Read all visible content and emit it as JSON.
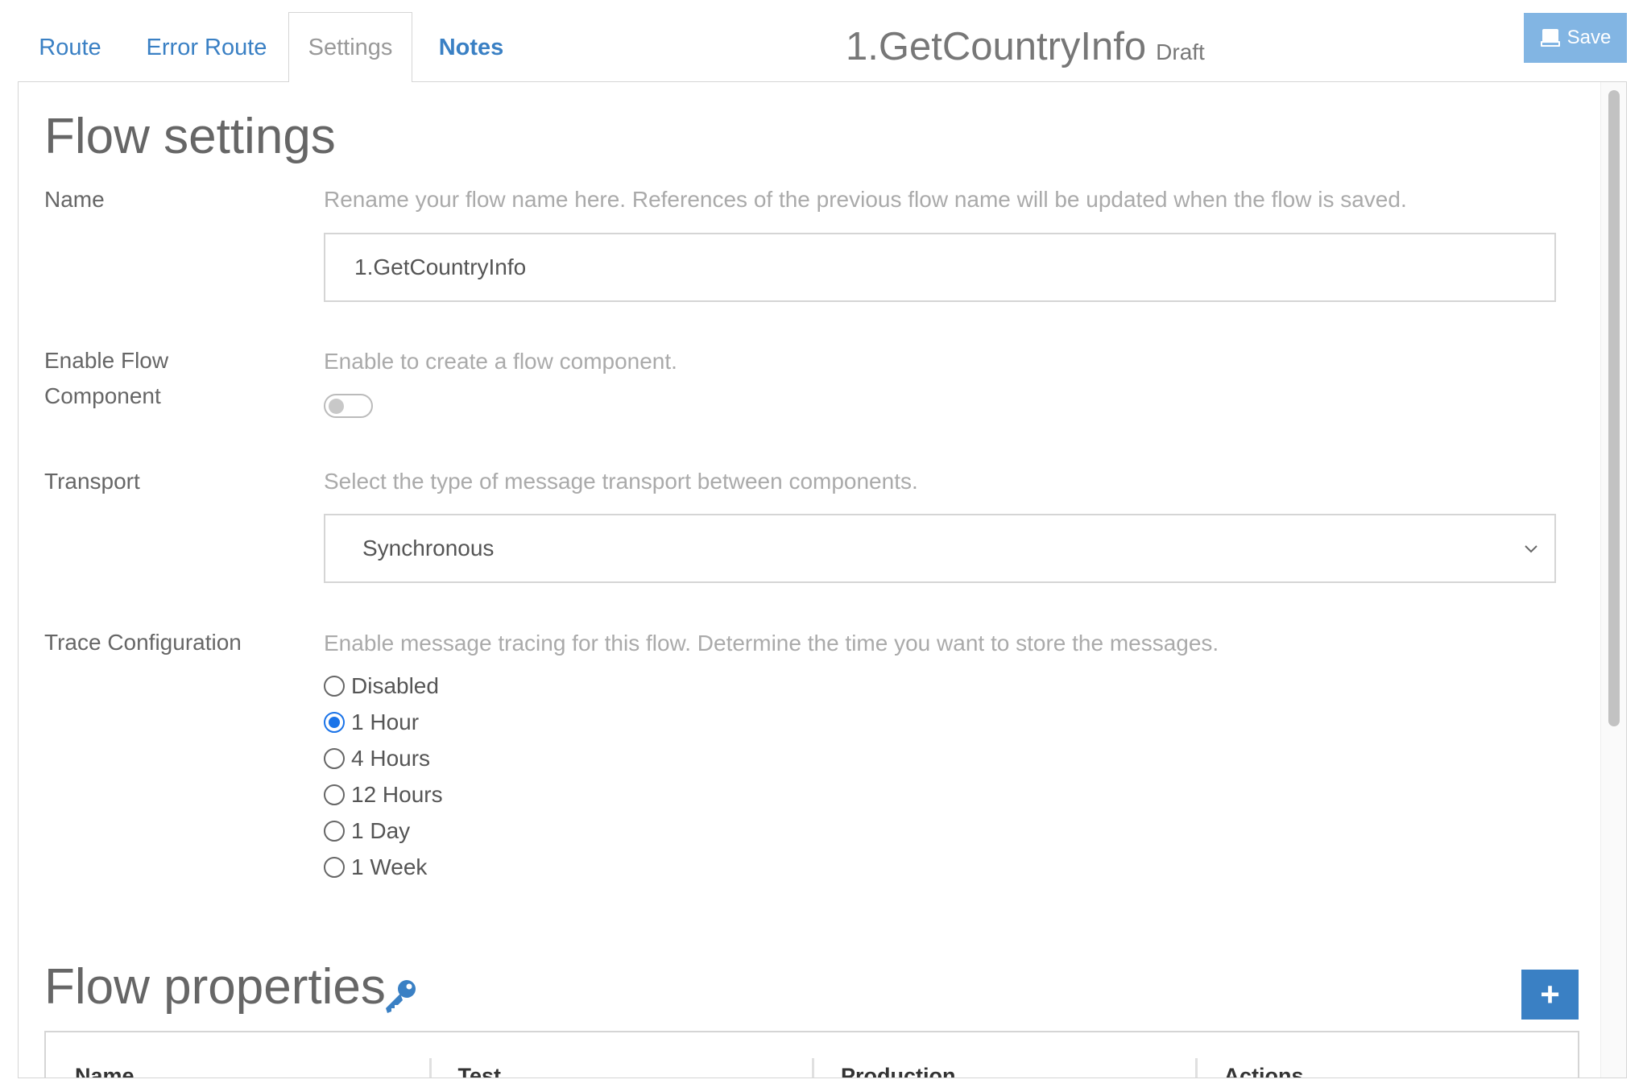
{
  "tabs": {
    "route": "Route",
    "error_route": "Error Route",
    "settings": "Settings",
    "notes": "Notes"
  },
  "header": {
    "flow_name": "1.GetCountryInfo",
    "status": "Draft",
    "save_label": "Save"
  },
  "flow_settings": {
    "heading": "Flow settings",
    "name": {
      "label": "Name",
      "help": "Rename your flow name here. References of the previous flow name will be updated when the flow is saved.",
      "value": "1.GetCountryInfo"
    },
    "enable_component": {
      "label": "Enable Flow Component",
      "help": "Enable to create a flow component.",
      "enabled": false
    },
    "transport": {
      "label": "Transport",
      "help": "Select the type of message transport between components.",
      "selected": "Synchronous"
    },
    "trace": {
      "label": "Trace Configuration",
      "help": "Enable message tracing for this flow. Determine the time you want to store the messages.",
      "options": [
        "Disabled",
        "1 Hour",
        "4 Hours",
        "12 Hours",
        "1 Day",
        "1 Week"
      ],
      "selected": "1 Hour"
    }
  },
  "flow_properties": {
    "heading": "Flow properties",
    "add_label": "+",
    "columns": [
      "Name",
      "Test",
      "Production",
      "Actions"
    ]
  },
  "colors": {
    "accent": "#3a80c4",
    "save_bg": "#82b5e3",
    "radio_checked": "#1a73e8"
  }
}
